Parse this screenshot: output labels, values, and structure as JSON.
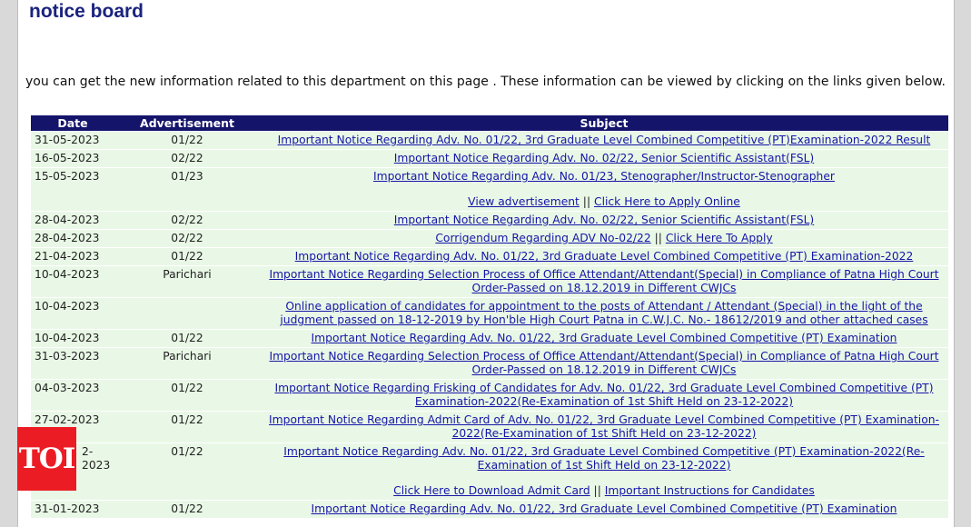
{
  "page": {
    "title": "notice board",
    "intro": "you can get the new information related to this department on this page . These information can be viewed by clicking on the links given below."
  },
  "table": {
    "headers": {
      "date": "Date",
      "advertisement": "Advertisement",
      "subject": "Subject"
    },
    "rows": [
      {
        "date": "31-05-2023",
        "adv": "01/22",
        "subject": "Important Notice Regarding Adv. No. 01/22, 3rd Graduate Level Combined Competitive (PT)Examination-2022 Result"
      },
      {
        "date": "16-05-2023",
        "adv": "02/22",
        "subject": "Important Notice Regarding Adv. No. 02/22, Senior Scientific Assistant(FSL)"
      },
      {
        "date": "15-05-2023",
        "adv": "01/23",
        "subject": "Important Notice Regarding Adv. No. 01/23, Stenographer/Instructor-Stenographer",
        "link1": "View advertisement",
        "link2": "Click Here to Apply Online"
      },
      {
        "date": "28-04-2023",
        "adv": "02/22",
        "subject": "Important Notice Regarding Adv. No. 02/22, Senior Scientific Assistant(FSL)"
      },
      {
        "date": "28-04-2023",
        "adv": "02/22",
        "subject": "Corrigendum Regarding ADV No-02/22",
        "link2": "Click Here To Apply"
      },
      {
        "date": "21-04-2023",
        "adv": "01/22",
        "subject": "Important Notice Regarding Adv. No. 01/22, 3rd Graduate Level Combined Competitive (PT) Examination-2022"
      },
      {
        "date": "10-04-2023",
        "adv": "Parichari",
        "subject": "Important Notice Regarding Selection Process of Office Attendant/Attendant(Special) in Compliance of Patna High Court Order-Passed on 18.12.2019 in Different CWJCs"
      },
      {
        "date": "10-04-2023",
        "adv": "",
        "subject": "Online application of candidates for appointment to the posts of Attendant / Attendant (Special) in the light of the judgment passed on 18-12-2019 by Hon'ble High Court Patna in C.W.J.C. No.- 18612/2019 and other attached cases"
      },
      {
        "date": "10-04-2023",
        "adv": "01/22",
        "subject": "Important Notice Regarding Adv. No. 01/22, 3rd Graduate Level Combined Competitive (PT) Examination"
      },
      {
        "date": "31-03-2023",
        "adv": "Parichari",
        "subject": "Important Notice Regarding Selection Process of Office Attendant/Attendant(Special) in Compliance of Patna High Court Order-Passed on 18.12.2019 in Different CWJCs"
      },
      {
        "date": "04-03-2023",
        "adv": "01/22",
        "subject": "Important Notice Regarding Frisking of Candidates for Adv. No. 01/22, 3rd Graduate Level Combined Competitive (PT) Examination-2022(Re-Examination of 1st Shift Held on 23-12-2022)"
      },
      {
        "date": "27-02-2023",
        "adv": "01/22",
        "subject": "Important Notice Regarding Admit Card of Adv. No. 01/22, 3rd Graduate Level Combined Competitive (PT) Examination-2022(Re-Examination of 1st Shift Held on 23-12-2022)"
      },
      {
        "date": "2-2023",
        "adv": "01/22",
        "subject": "Important Notice Regarding Adv. No. 01/22, 3rd Graduate Level Combined Competitive (PT) Examination-2022(Re-Examination of 1st Shift Held on 23-12-2022)",
        "link1": "Click Here to Download Admit Card",
        "link2": "Important Instructions for Candidates"
      },
      {
        "date": "31-01-2023",
        "adv": "01/22",
        "subject": "Important Notice Regarding Adv. No. 01/22, 3rd Graduate Level Combined Competitive (PT) Examination"
      }
    ],
    "link_separator": "||"
  },
  "watermark": {
    "logo_text": "TOI"
  },
  "colors": {
    "header_bg": "#14146b",
    "row_bg": "#e9f8e6",
    "link": "#1515a8",
    "title": "#1a237e",
    "logo_bg": "#ec1c24"
  }
}
